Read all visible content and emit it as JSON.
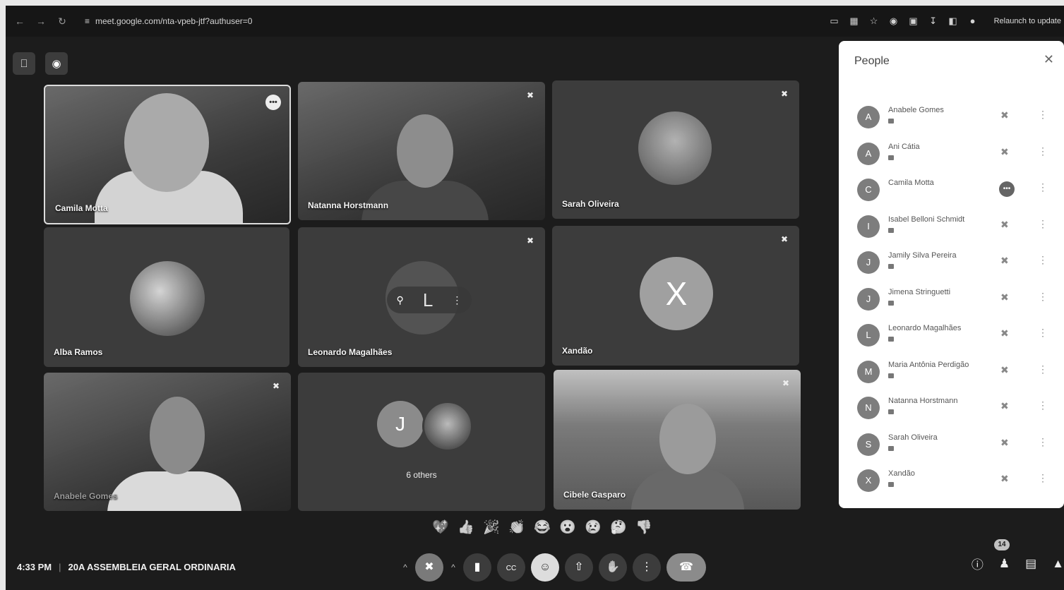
{
  "browser": {
    "url": "meet.google.com/nta-vpeb-jtf?authuser=0",
    "relaunch_label": "Relaunch to update"
  },
  "tiles": [
    {
      "name": "Camila Motta",
      "state": "speaking"
    },
    {
      "name": "Natanna Horstmann",
      "state": "muted"
    },
    {
      "name": "Sarah Oliveira",
      "state": "muted"
    },
    {
      "name": "Alba Ramos",
      "state": "none"
    },
    {
      "name": "Leonardo Magalhães",
      "state": "muted",
      "initial": "L"
    },
    {
      "name": "Xandão",
      "state": "muted",
      "initial": "X"
    },
    {
      "name": "Anabele Gomes",
      "state": "muted"
    },
    {
      "name": "6 others",
      "state": "group",
      "initial": "J"
    },
    {
      "name": "Cibele Gasparo",
      "state": "muted"
    }
  ],
  "people_panel": {
    "title": "People",
    "participants": [
      {
        "name": "Anabele Gomes",
        "initial": "A",
        "state": "muted"
      },
      {
        "name": "Ani Cátia",
        "initial": "A",
        "state": "muted"
      },
      {
        "name": "Camila Motta",
        "initial": "C",
        "state": "speaking"
      },
      {
        "name": "Isabel Belloni Schmidt",
        "initial": "I",
        "state": "muted"
      },
      {
        "name": "Jamily Silva Pereira",
        "initial": "J",
        "state": "muted"
      },
      {
        "name": "Jimena Stringuetti",
        "initial": "J",
        "state": "muted"
      },
      {
        "name": "Leonardo Magalhães",
        "initial": "L",
        "state": "muted"
      },
      {
        "name": "Maria Antônia Perdigão",
        "initial": "M",
        "state": "muted"
      },
      {
        "name": "Natanna Horstmann",
        "initial": "N",
        "state": "muted"
      },
      {
        "name": "Sarah Oliveira",
        "initial": "S",
        "state": "muted"
      },
      {
        "name": "Xandão",
        "initial": "X",
        "state": "muted"
      }
    ]
  },
  "reactions": [
    "💖",
    "👍",
    "🎉",
    "👏",
    "😂",
    "😮",
    "😢",
    "🤔",
    "👎"
  ],
  "meeting": {
    "time": "4:33 PM",
    "title": "20A ASSEMBLEIA GERAL ORDINARIA"
  },
  "people_count": "14"
}
